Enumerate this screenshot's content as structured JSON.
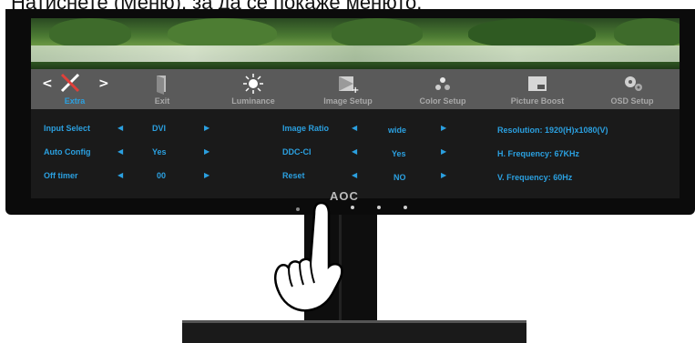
{
  "caption": "Натиснете      (Меню), за да се покаже менюто.",
  "brand_logo": "AOC",
  "menu": {
    "tabs": [
      {
        "label": "Extra",
        "icon": "tools-icon",
        "active": true
      },
      {
        "label": "Exit",
        "icon": "exit-door-icon",
        "active": false
      },
      {
        "label": "Luminance",
        "icon": "sun-icon",
        "active": false
      },
      {
        "label": "Image Setup",
        "icon": "image-setup-icon",
        "active": false
      },
      {
        "label": "Color Setup",
        "icon": "color-dots-icon",
        "active": false
      },
      {
        "label": "Picture Boost",
        "icon": "picture-boost-icon",
        "active": false
      },
      {
        "label": "OSD Setup",
        "icon": "osd-gear-icon",
        "active": false
      }
    ],
    "left_arrow": "<",
    "right_arrow": ">"
  },
  "settings": {
    "input_select": {
      "label": "Input Select",
      "value": "DVI"
    },
    "auto_config": {
      "label": "Auto Config",
      "value": "Yes"
    },
    "off_timer": {
      "label": "Off timer",
      "value": "00"
    },
    "image_ratio": {
      "label": "Image Ratio",
      "value": "wide"
    },
    "ddc_ci": {
      "label": "DDC-CI",
      "value": "Yes"
    },
    "reset": {
      "label": "Reset",
      "value": "NO"
    }
  },
  "info": {
    "resolution": "Resolution:  1920(H)x1080(V)",
    "h_frequency": "H. Frequency:  67KHz",
    "v_frequency": "V. Frequency:  60Hz"
  },
  "colors": {
    "accent": "#2ba0e0",
    "menubar": "#5a5a5a",
    "content_bg": "#1a1a1a"
  }
}
